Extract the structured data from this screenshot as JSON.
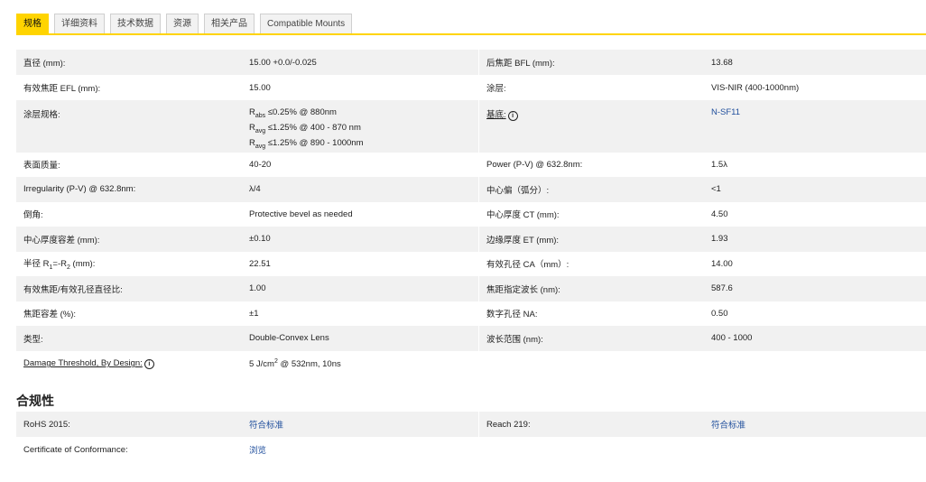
{
  "tabs": [
    "规格",
    "详细资料",
    "技术数据",
    "资源",
    "相关产品",
    "Compatible Mounts"
  ],
  "specs": {
    "r1": {
      "l1": "直径 (mm):",
      "v1": "15.00 +0.0/-0.025",
      "l2": "后焦距 BFL (mm):",
      "v2": "13.68"
    },
    "r2": {
      "l1": "有效焦距 EFL (mm):",
      "v1": "15.00",
      "l2": "涂层:",
      "v2": "VIS-NIR (400-1000nm)"
    },
    "r3": {
      "l1": "涂层规格:",
      "c1_sub": "abs",
      "c1_text": "≤0.25% @ 880nm",
      "c2_sub": "avg",
      "c2_text": "≤1.25% @ 400 - 870 nm",
      "c3_sub": "avg",
      "c3_text": "≤1.25% @ 890 - 1000nm",
      "r_letter": "R",
      "l2": "基底:",
      "info": "i",
      "v2": "N-SF11"
    },
    "r4": {
      "l1": "表面质量:",
      "v1": "40-20",
      "l2": "Power (P-V) @ 632.8nm:",
      "v2": "1.5λ"
    },
    "r5": {
      "l1": "Irregularity (P-V) @ 632.8nm:",
      "v1": "λ/4",
      "l2": "中心偏（弧分）:",
      "v2": "<1"
    },
    "r6": {
      "l1": "倒角:",
      "v1": "Protective bevel as needed",
      "l2": "中心厚度 CT (mm):",
      "v2": "4.50"
    },
    "r7": {
      "l1": "中心厚度容差 (mm):",
      "v1": "±0.10",
      "l2": "边缘厚度 ET (mm):",
      "v2": "1.93"
    },
    "r8": {
      "l1_pre": "半径 R",
      "l1_sub1": "1",
      "l1_mid": "=-R",
      "l1_sub2": "2",
      "l1_post": " (mm):",
      "v1": "22.51",
      "l2": "有效孔径 CA（mm）:",
      "v2": "14.00"
    },
    "r9": {
      "l1": "有效焦距/有效孔径直径比:",
      "v1": "1.00",
      "l2": "焦距指定波长 (nm):",
      "v2": "587.6"
    },
    "r10": {
      "l1": "焦距容差 (%):",
      "v1": "±1",
      "l2": "数字孔径 NA:",
      "v2": "0.50"
    },
    "r11": {
      "l1": "类型:",
      "v1": "Double-Convex Lens",
      "l2": "波长范围 (nm):",
      "v2": "400 - 1000"
    },
    "r12": {
      "l1": "Damage Threshold, By Design:",
      "info": "i",
      "v1_pre": "5 J/cm",
      "v1_sup": "2",
      "v1_post": " @ 532nm, 10ns"
    }
  },
  "compliance": {
    "title": "合规性",
    "r1": {
      "l1": "RoHS 2015:",
      "v1": "符合标准",
      "l2": "Reach 219:",
      "v2": "符合标准"
    },
    "r2": {
      "l1": "Certificate of Conformance:",
      "v1": "浏览"
    }
  },
  "colors": {
    "accent": "#ffd400",
    "link": "#1f4e9c",
    "row_shade": "#f1f1f1"
  }
}
